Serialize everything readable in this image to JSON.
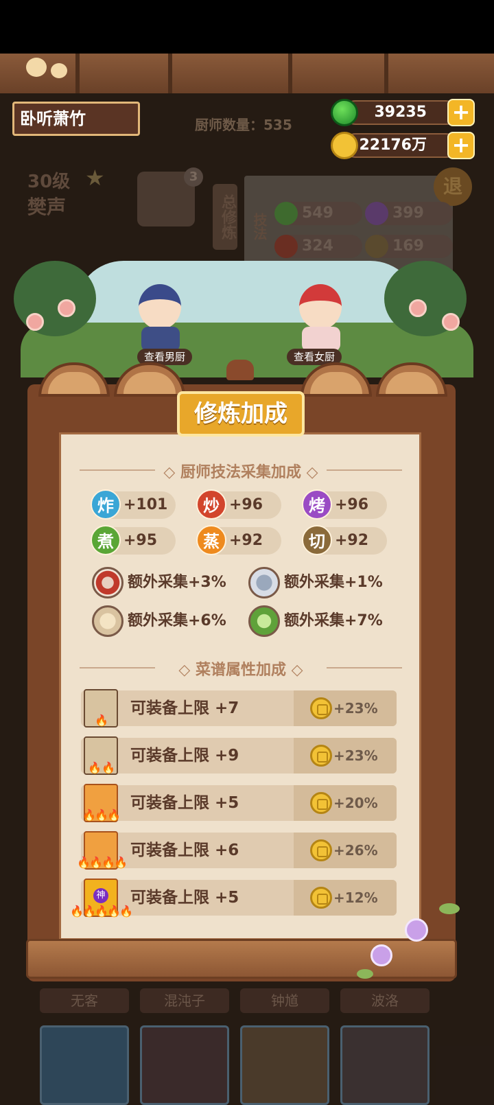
{
  "header": {
    "player_name": "卧听萧竹",
    "chef_count_label": "厨师数量：535",
    "jade_amount": "39235",
    "coin_amount": "22176万"
  },
  "background": {
    "level_text": "30级",
    "chef_name": "樊声",
    "badge_count": "3",
    "cultivate_label": "总修炼",
    "technique_label": "技法",
    "exit_label": "退",
    "stats": [
      {
        "icon": "煮",
        "value": "549"
      },
      {
        "icon": "烤",
        "value": "399"
      },
      {
        "icon": "炒",
        "value": "324"
      },
      {
        "icon": "切",
        "value": "169"
      }
    ],
    "bottom_names": [
      "无客",
      "混沌子",
      "钟馗",
      "波洛"
    ]
  },
  "buttons": {
    "view_male": "查看男厨",
    "view_female": "查看女厨"
  },
  "panel": {
    "title": "修炼加成",
    "section1_title": "厨师技法采集加成",
    "skills": [
      {
        "icon": "炸",
        "value": "+101",
        "color": "#3aa6d6"
      },
      {
        "icon": "炒",
        "value": "+96",
        "color": "#d2452c"
      },
      {
        "icon": "烤",
        "value": "+96",
        "color": "#9a4bc4"
      },
      {
        "icon": "煮",
        "value": "+95",
        "color": "#5aa636"
      },
      {
        "icon": "蒸",
        "value": "+92",
        "color": "#ee8a1e"
      },
      {
        "icon": "切",
        "value": "+92",
        "color": "#8a6a3a"
      }
    ],
    "extras": [
      {
        "icon": "meat-icon",
        "label": "额外采集+3%"
      },
      {
        "icon": "fish-icon",
        "label": "额外采集+1%"
      },
      {
        "icon": "flour-icon",
        "label": "额外采集+6%"
      },
      {
        "icon": "vegetable-icon",
        "label": "额外采集+7%"
      }
    ],
    "section2_title": "菜谱属性加成",
    "recipes": [
      {
        "label": "可装备上限 +7",
        "bonus": "+23%",
        "stars": 1
      },
      {
        "label": "可装备上限 +9",
        "bonus": "+23%",
        "stars": 2
      },
      {
        "label": "可装备上限 +5",
        "bonus": "+20%",
        "stars": 3
      },
      {
        "label": "可装备上限 +6",
        "bonus": "+26%",
        "stars": 4
      },
      {
        "label": "可装备上限 +5",
        "bonus": "+12%",
        "stars": 5
      }
    ],
    "god_badge": "神"
  }
}
